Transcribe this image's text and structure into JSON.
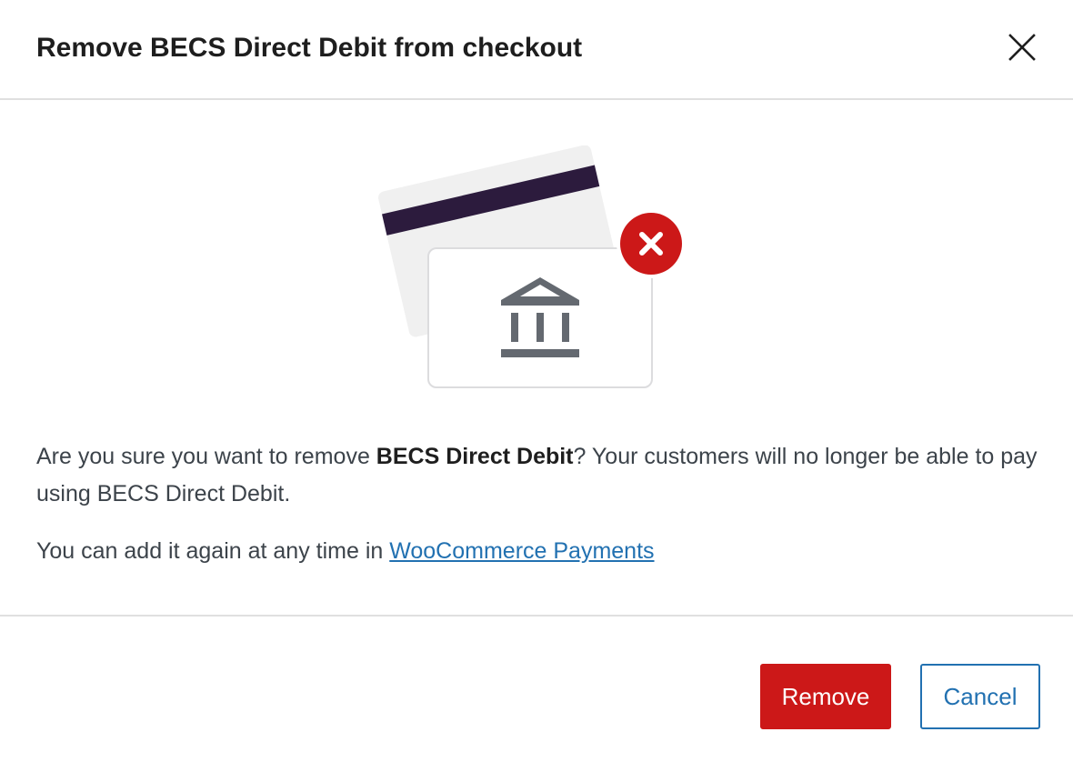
{
  "modal": {
    "title": "Remove BECS Direct Debit from checkout",
    "close_icon": "close-icon"
  },
  "illustration": {
    "icons": [
      "card-back-icon",
      "bank-icon",
      "error-x-icon"
    ],
    "colors": {
      "card_back": "#f0f0f0",
      "stripe": "#2c1b3d",
      "card_border": "#dcdcde",
      "bank": "#646970",
      "badge": "#cc1818"
    }
  },
  "body": {
    "p1_before": "Are you sure you want to remove ",
    "p1_bold": "BECS Direct Debit",
    "p1_after": "? Your customers will no longer be able to pay using BECS Direct Debit.",
    "p2_before": "You can add it again at any time in ",
    "p2_link": "WooCommerce Payments"
  },
  "footer": {
    "remove_label": "Remove",
    "cancel_label": "Cancel"
  },
  "colors": {
    "danger": "#cc1818",
    "link": "#2271b1",
    "divider": "#e0e0e0"
  }
}
